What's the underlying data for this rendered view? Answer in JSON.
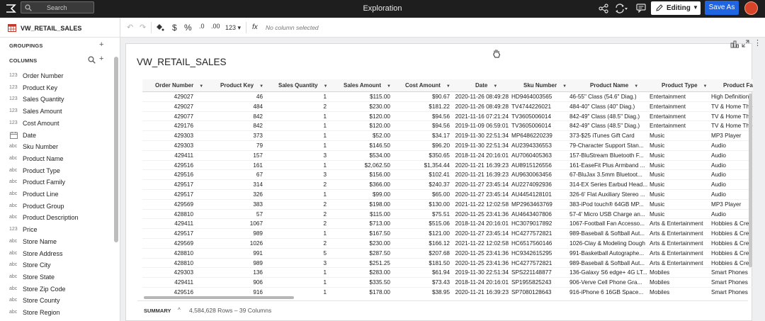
{
  "topbar": {
    "search_placeholder": "Search",
    "title": "Exploration",
    "edit_label": "Editing",
    "save_as_label": "Save As"
  },
  "left_panel": {
    "dataset_name": "VW_RETAIL_SALES",
    "groupings_label": "GROUPINGS",
    "columns_label": "COLUMNS",
    "columns": [
      {
        "type": "123",
        "name": "Order Number"
      },
      {
        "type": "123",
        "name": "Product Key"
      },
      {
        "type": "123",
        "name": "Sales Quantity"
      },
      {
        "type": "123",
        "name": "Sales Amount"
      },
      {
        "type": "123",
        "name": "Cost Amount"
      },
      {
        "type": "date",
        "name": "Date"
      },
      {
        "type": "abc",
        "name": "Sku Number"
      },
      {
        "type": "abc",
        "name": "Product Name"
      },
      {
        "type": "abc",
        "name": "Product Type"
      },
      {
        "type": "abc",
        "name": "Product Family"
      },
      {
        "type": "abc",
        "name": "Product Line"
      },
      {
        "type": "abc",
        "name": "Product Group"
      },
      {
        "type": "abc",
        "name": "Product Description"
      },
      {
        "type": "123",
        "name": "Price"
      },
      {
        "type": "abc",
        "name": "Store Name"
      },
      {
        "type": "abc",
        "name": "Store Address"
      },
      {
        "type": "abc",
        "name": "Store City"
      },
      {
        "type": "abc",
        "name": "Store State"
      },
      {
        "type": "abc",
        "name": "Store Zip Code"
      },
      {
        "type": "abc",
        "name": "Store County"
      },
      {
        "type": "abc",
        "name": "Store Region"
      }
    ]
  },
  "toolbar": {
    "number_format": "123",
    "no_column": "No column selected"
  },
  "main": {
    "title": "VW_RETAIL_SALES",
    "headers": [
      "Order Number",
      "Product Key",
      "Sales Quantity",
      "Sales Amount",
      "Cost Amount",
      "Date",
      "Sku Number",
      "Product Name",
      "Product Type",
      "Product Fa"
    ],
    "rows": [
      [
        "429027",
        "46",
        "1",
        "$115.00",
        "$90.67",
        "2020-11-26 08:49:28",
        "HD9464003565",
        "46-55\" Class (54.6\" Diag.)",
        "Entertainment",
        "High Definition"
      ],
      [
        "429027",
        "484",
        "2",
        "$230.00",
        "$181.22",
        "2020-11-26 08:49:28",
        "TV4744226021",
        "484-40\" Class (40\" Diag.)",
        "Entertainment",
        "TV & Home The"
      ],
      [
        "429077",
        "842",
        "1",
        "$120.00",
        "$94.56",
        "2021-11-16 07:21:24",
        "TV3605006014",
        "842-49\" Class (48.5\" Diag.)",
        "Entertainment",
        "TV & Home The"
      ],
      [
        "429176",
        "842",
        "1",
        "$120.00",
        "$94.56",
        "2019-11-09 06:59:01",
        "TV3605006014",
        "842-49\" Class (48.5\" Diag.)",
        "Entertainment",
        "TV & Home The"
      ],
      [
        "429303",
        "373",
        "1",
        "$52.00",
        "$34.17",
        "2019-11-30 22:51:34",
        "MP6486220239",
        "373-$25 iTunes Gift Card",
        "Music",
        "MP3 Player"
      ],
      [
        "429303",
        "79",
        "1",
        "$146.50",
        "$96.20",
        "2019-11-30 22:51:34",
        "AU2394336553",
        "79-Character Support Stan...",
        "Music",
        "Audio"
      ],
      [
        "429411",
        "157",
        "3",
        "$534.00",
        "$350.65",
        "2018-11-24 20:16:01",
        "AU7060405363",
        "157-BluStream Bluetooth F...",
        "Music",
        "Audio"
      ],
      [
        "429516",
        "161",
        "1",
        "$2,062.50",
        "$1,354.44",
        "2020-11-21 16:39:23",
        "AU8915126556",
        "161-EaseFit Plus Armband ...",
        "Music",
        "Audio"
      ],
      [
        "429516",
        "67",
        "3",
        "$156.00",
        "$102.41",
        "2020-11-21 16:39:23",
        "AU9630063456",
        "67-BluJax 3.5mm Bluetoot...",
        "Music",
        "Audio"
      ],
      [
        "429517",
        "314",
        "2",
        "$366.00",
        "$240.37",
        "2020-11-27 23:45:14",
        "AU2274092936",
        "314-EX Series Earbud Head...",
        "Music",
        "Audio"
      ],
      [
        "429517",
        "326",
        "1",
        "$99.00",
        "$65.00",
        "2020-11-27 23:45:14",
        "AU4454128101",
        "326-6' Flat Auxiliary Stereo ...",
        "Music",
        "Audio"
      ],
      [
        "429569",
        "383",
        "2",
        "$198.00",
        "$130.00",
        "2021-11-22 12:02:58",
        "MP2963463769",
        "383-iPod touch® 64GB MP...",
        "Music",
        "MP3 Player"
      ],
      [
        "428810",
        "57",
        "2",
        "$115.00",
        "$75.51",
        "2020-11-25 23:41:36",
        "AU4643407806",
        "57-4' Micro USB Charge an...",
        "Music",
        "Audio"
      ],
      [
        "429411",
        "1067",
        "2",
        "$713.00",
        "$515.06",
        "2018-11-24 20:16:01",
        "HC3079017892",
        "1067-Football Fan Accesso...",
        "Arts & Entertainment",
        "Hobbies & Crea"
      ],
      [
        "429517",
        "989",
        "1",
        "$167.50",
        "$121.00",
        "2020-11-27 23:45:14",
        "HC4277572821",
        "989-Baseball & Softball Aut...",
        "Arts & Entertainment",
        "Hobbies & Crea"
      ],
      [
        "429569",
        "1026",
        "2",
        "$230.00",
        "$166.12",
        "2021-11-22 12:02:58",
        "HC6517560146",
        "1026-Clay & Modeling Dough",
        "Arts & Entertainment",
        "Hobbies & Crea"
      ],
      [
        "428810",
        "991",
        "5",
        "$287.50",
        "$207.68",
        "2020-11-25 23:41:36",
        "HC9342615295",
        "991-Basketball Autographe...",
        "Arts & Entertainment",
        "Hobbies & Crea"
      ],
      [
        "428810",
        "989",
        "3",
        "$251.25",
        "$181.50",
        "2020-11-25 23:41:36",
        "HC4277572821",
        "989-Baseball & Softball Aut...",
        "Arts & Entertainment",
        "Hobbies & Crea"
      ],
      [
        "429303",
        "136",
        "1",
        "$283.00",
        "$61.94",
        "2019-11-30 22:51:34",
        "SPS221148877",
        "136-Galaxy S6 edge+ 4G LT...",
        "Mobiles",
        "Smart Phones"
      ],
      [
        "429411",
        "906",
        "1",
        "$335.50",
        "$73.43",
        "2018-11-24 20:16:01",
        "SP1955825243",
        "906-Verve Cell Phone  Gra...",
        "Mobiles",
        "Smart Phones"
      ],
      [
        "429516",
        "916",
        "1",
        "$178.00",
        "$38.95",
        "2020-11-21 16:39:23",
        "SP7080128643",
        "916-iPhone 6 16GB  Space...",
        "Mobiles",
        "Smart Phones"
      ]
    ],
    "summary_label": "SUMMARY",
    "summary_text": "4,584,628 Rows – 39 Columns"
  },
  "colors": {
    "accent": "#1f64e0",
    "topbar_bg": "#1e1e1e",
    "avatar": "#d8442a"
  }
}
